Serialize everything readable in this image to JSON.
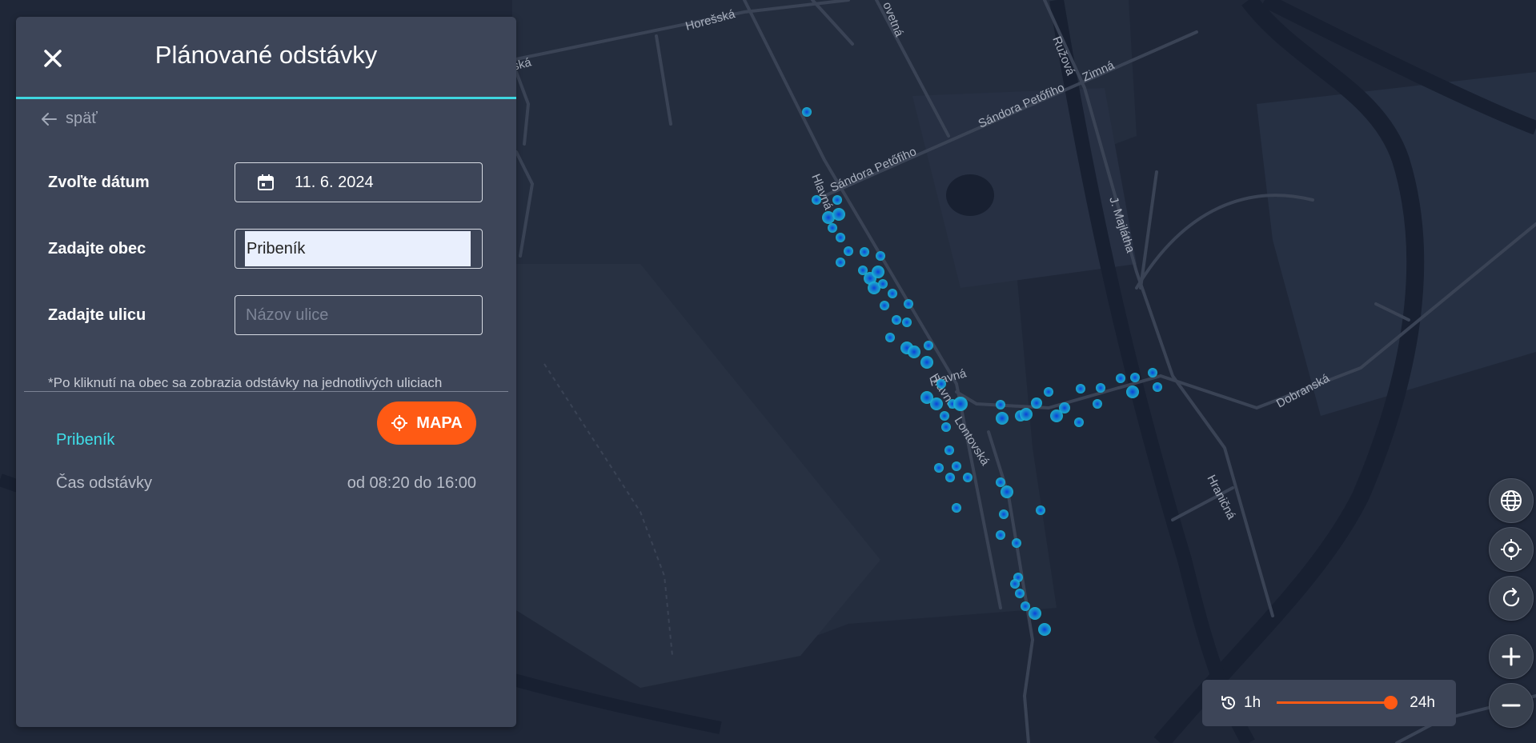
{
  "map": {
    "streets": [
      "Horešská",
      "ská",
      "ovetná",
      "Ružová",
      "Zimná",
      "Sándora Petőfiho",
      "Sándora Petőfiho",
      "Hlavná",
      "J. Majlátha",
      "Hlavná",
      "Hlavná",
      "Lontovská",
      "Dobranská",
      "Hraničná"
    ]
  },
  "panel": {
    "title": "Plánované odstávky",
    "back_label": "späť",
    "date_label": "Zvoľte dátum",
    "date_value": "11. 6. 2024",
    "town_label": "Zadajte obec",
    "town_value": "Pribeník",
    "street_label": "Zadajte ulicu",
    "street_placeholder": "Názov ulice",
    "note": "*Po kliknutí na obec sa zobrazia odstávky na jednotlivých uliciach",
    "result": {
      "town": "Pribeník",
      "map_button": "MAPA",
      "time_label": "Čas odstávky",
      "time_value": "od 08:20 do 16:00"
    }
  },
  "timebar": {
    "start_label": "1h",
    "end_label": "24h",
    "value_fraction": 1.0
  },
  "colors": {
    "accent": "#3fd6e0",
    "orange": "#ff5a14",
    "panel": "#3d4558",
    "map_bg": "#1e2636"
  },
  "controls": [
    "globe-icon",
    "locate-icon",
    "refresh-icon",
    "zoom-in-icon",
    "zoom-out-icon"
  ]
}
